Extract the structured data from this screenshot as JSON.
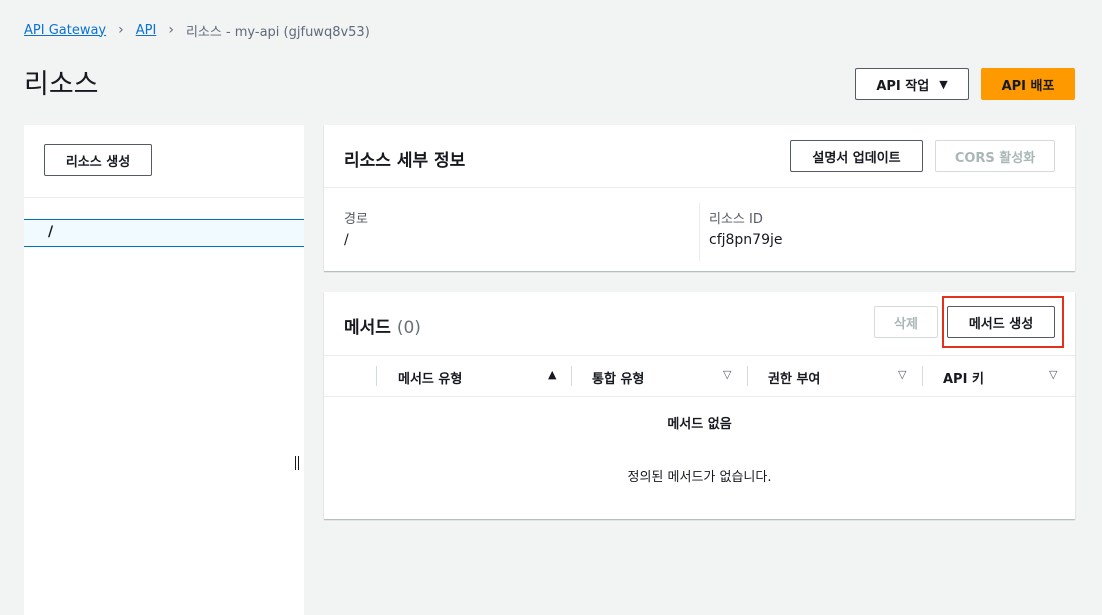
{
  "breadcrumb": {
    "items": [
      "API Gateway",
      "API"
    ],
    "current": "리소스 - my-api (gjfuwq8v53)"
  },
  "page": {
    "title": "리소스",
    "actions_label": "API 작업",
    "deploy_label": "API 배포"
  },
  "tree": {
    "create_label": "리소스 생성",
    "root_label": "/"
  },
  "details": {
    "title": "리소스 세부 정보",
    "update_doc_label": "설명서 업데이트",
    "cors_label": "CORS 활성화",
    "path_label": "경로",
    "path_value": "/",
    "id_label": "리소스 ID",
    "id_value": "cfj8pn79je"
  },
  "methods": {
    "title": "메서드",
    "count": "(0)",
    "delete_label": "삭제",
    "create_label": "메서드 생성",
    "columns": [
      "메서드 유형",
      "통합 유형",
      "권한 부여",
      "API 키"
    ],
    "empty_title": "메서드 없음",
    "empty_message": "정의된 메서드가 없습니다."
  },
  "colors": {
    "primary": "#ff9900",
    "link": "#0972d3",
    "highlight": "#e4311e"
  }
}
